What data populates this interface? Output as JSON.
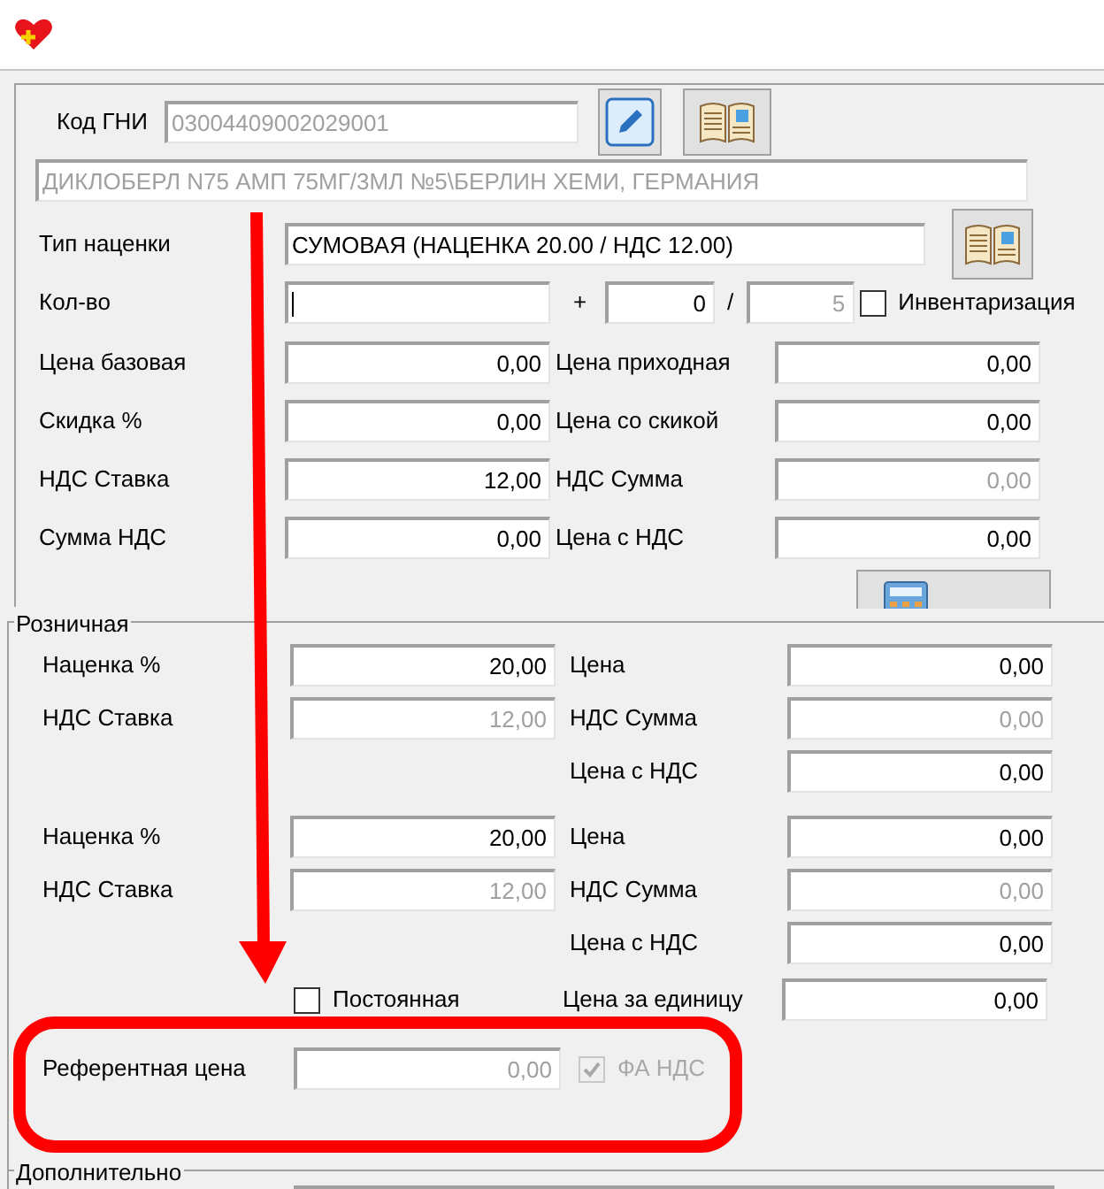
{
  "header": {
    "code_label": "Код ГНИ",
    "code_value": "03004409002029001",
    "product_name": "ДИКЛОБЕРЛ N75 АМП 75МГ/3МЛ №5\\БЕРЛИН ХЕМИ, ГЕРМАНИЯ"
  },
  "markup_type": {
    "label": "Тип наценки",
    "value": "СУМОВАЯ (НАЦЕНКА 20.00 / НДС 12.00)"
  },
  "quantity": {
    "label": "Кол-во",
    "plus": "+",
    "extra": "0",
    "slash": "/",
    "total": "5",
    "total_disabled": true,
    "inventory": {
      "label": "Инвентаризация",
      "checked": false
    }
  },
  "purchase_rows": [
    {
      "label": "Цена базовая",
      "value": "0,00",
      "right_label": "Цена приходная",
      "right_value": "0,00",
      "right_disabled": false
    },
    {
      "label": "Скидка %",
      "value": "0,00",
      "right_label": "Цена со скикой",
      "right_value": "0,00",
      "right_disabled": false
    },
    {
      "label": "НДС Ставка",
      "value": "12,00",
      "right_label": "НДС Сумма",
      "right_value": "0,00",
      "right_disabled": true
    },
    {
      "label": "Сумма НДС",
      "value": "0,00",
      "right_label": "Цена с НДС",
      "right_value": "0,00",
      "right_disabled": false
    }
  ],
  "retail": {
    "title": "Розничная",
    "groups": [
      {
        "rows": [
          {
            "label": "Наценка %",
            "value": "20,00",
            "disabled": false,
            "right_label": "Цена",
            "right_value": "0,00",
            "right_disabled": false
          },
          {
            "label": "НДС Ставка",
            "value": "12,00",
            "disabled": true,
            "right_label": "НДС Сумма",
            "right_value": "0,00",
            "right_disabled": true
          },
          {
            "right_label": "Цена с НДС",
            "right_value": "0,00",
            "right_disabled": false
          }
        ]
      },
      {
        "rows": [
          {
            "label": "Наценка %",
            "value": "20,00",
            "disabled": false,
            "right_label": "Цена",
            "right_value": "0,00",
            "right_disabled": false
          },
          {
            "label": "НДС Ставка",
            "value": "12,00",
            "disabled": true,
            "right_label": "НДС Сумма",
            "right_value": "0,00",
            "right_disabled": true
          },
          {
            "right_label": "Цена с НДС",
            "right_value": "0,00",
            "right_disabled": false
          }
        ]
      }
    ],
    "constant": {
      "label": "Постоянная",
      "checked": false
    },
    "unit_price": {
      "label": "Цена за единицу",
      "value": "0,00"
    },
    "reference": {
      "label": "Референтная цена",
      "value": "0,00",
      "disabled": true
    },
    "fa_vat": {
      "label": "ФА НДС",
      "checked": true,
      "disabled": true
    }
  },
  "additional": {
    "title": "Дополнительно"
  }
}
